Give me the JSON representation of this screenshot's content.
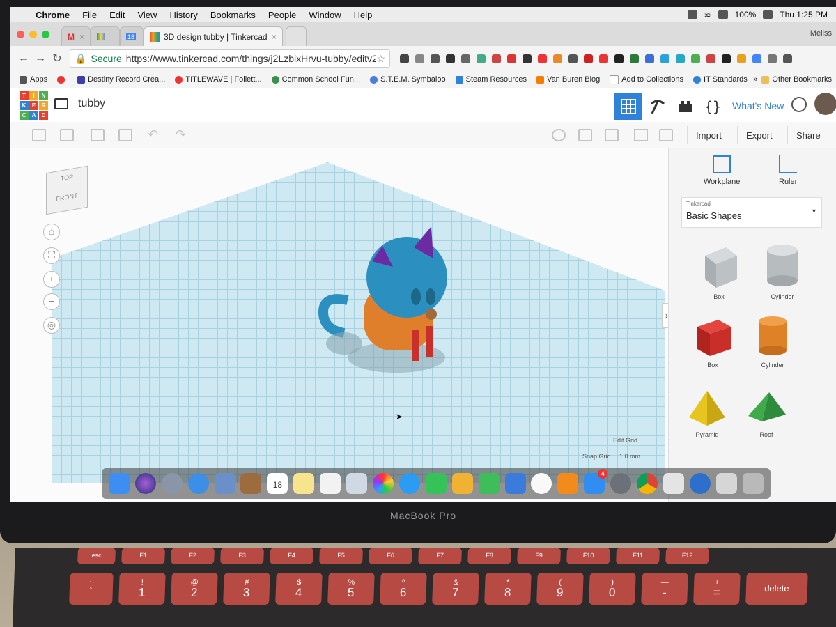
{
  "menubar": {
    "items": [
      "Chrome",
      "File",
      "Edit",
      "View",
      "History",
      "Bookmarks",
      "People",
      "Window",
      "Help"
    ],
    "battery": "100%",
    "clock": "Thu 1:25 PM"
  },
  "tabs": [
    {
      "label": ""
    },
    {
      "label": ""
    },
    {
      "label": "18"
    },
    {
      "label": "3D design tubby | Tinkercad"
    }
  ],
  "profile_name": "Meliss",
  "address": {
    "secure_label": "Secure",
    "url": "https://www.tinkercad.com/things/j2LzbixHrvu-tubby/editv2?..."
  },
  "bookmarks": [
    "Apps",
    "Destiny Record Crea...",
    "TITLEWAVE | Follett...",
    "Common School Fun...",
    "S.T.E.M. Symbaloo",
    "Steam Resources",
    "Van Buren Blog",
    "Add to Collections",
    "IT Standards"
  ],
  "bookmarks_overflow": "»",
  "bookmarks_other": "Other Bookmarks",
  "tinkercad": {
    "logo_letters": [
      "TIN",
      "KER",
      "CAD"
    ],
    "design_name": "tubby",
    "whats_new": "What's New",
    "actions": [
      "Import",
      "Export",
      "Share"
    ]
  },
  "workplane": {
    "view_cube_top": "TOP",
    "view_cube_front": "FRONT",
    "edit_grid": "Edit Grid",
    "snap_grid_label": "Snap Grid",
    "snap_grid_value": "1.0 mm"
  },
  "panel": {
    "workplane_tool": "Workplane",
    "ruler_tool": "Ruler",
    "library_sub": "Tinkercad",
    "library_name": "Basic Shapes",
    "shapes": [
      "Box",
      "Cylinder",
      "Box",
      "Cylinder",
      "Pyramid",
      "Roof"
    ]
  },
  "dock": {
    "calendar_day": "18",
    "badge": "4"
  },
  "macbook_label": "MacBook Pro",
  "keyboard": {
    "fn_row": [
      "esc",
      "F1",
      "F2",
      "F3",
      "F4",
      "F5",
      "F6",
      "F7",
      "F8",
      "F9",
      "F10",
      "F11",
      "F12"
    ],
    "num_row_top": [
      "~",
      "!",
      "@",
      "#",
      "$",
      "%",
      "^",
      "&",
      "*",
      "(",
      ")",
      "—",
      "+",
      "delete"
    ],
    "num_row_bottom": [
      "`",
      "1",
      "2",
      "3",
      "4",
      "5",
      "6",
      "7",
      "8",
      "9",
      "0",
      "-",
      "="
    ]
  },
  "colors": {
    "tinkercad_blue": "#2f82d8",
    "grid": "#cfe9f2",
    "key_red": "#b84a44"
  }
}
